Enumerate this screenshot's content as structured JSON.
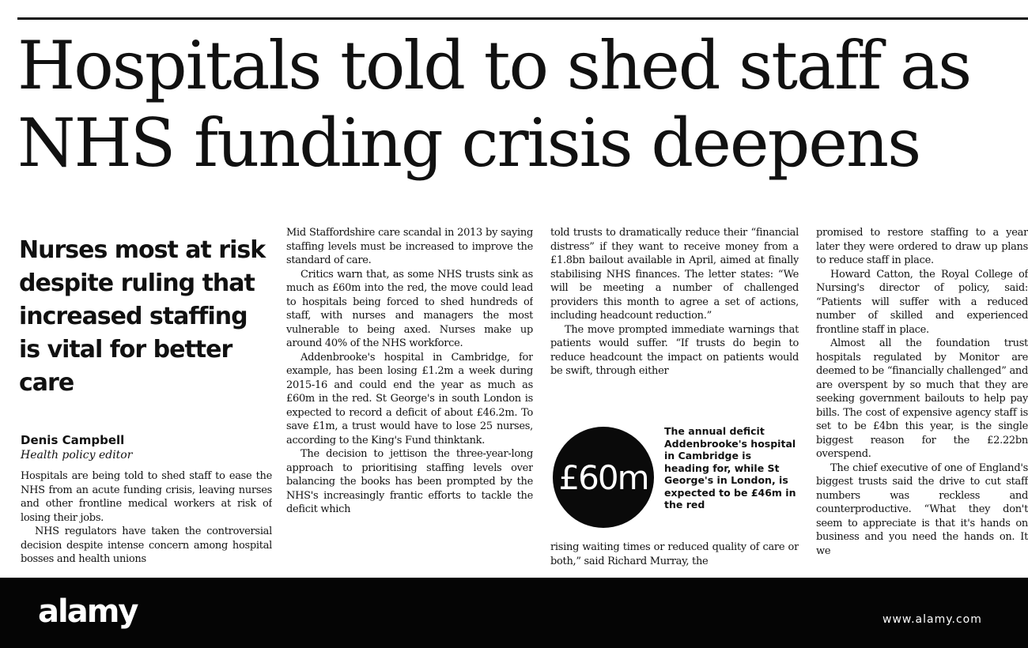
{
  "article": {
    "headline": [
      "Hospitals told to shed staff as",
      "NHS funding crisis deepens"
    ],
    "standfirst": "Nurses most at risk despite ruling that increased staffing is vital for better care",
    "byline": "Denis Campbell",
    "role": "Health policy editor",
    "col1": [
      "Hospitals are being told to shed staff to ease the NHS from an acute funding crisis, leaving nurses and other frontline medical workers at risk of losing their jobs.",
      "NHS regulators have taken the controversial decision despite intense concern among hospital bosses and health unions"
    ],
    "col2": [
      "Mid Staffordshire care scandal in 2013 by saying staffing levels must be increased to improve the standard of care.",
      "Critics warn that, as some NHS trusts sink as much as £60m into the red, the move could lead to hospitals being forced to shed hundreds of staff, with nurses and managers the most vulnerable to being axed. Nurses make up around 40% of the NHS workforce.",
      "Addenbrooke's hospital in Cambridge, for example, has been losing £1.2m a week during 2015-16 and could end the year as much as £60m in the red. St George's in south London is expected to record a deficit of about £46.2m. To save £1m, a trust would have to lose 25 nurses, according to the King's Fund thinktank.",
      "The decision to jettison the three-year-long approach to prioritising staffing levels over balancing the books has been prompted by the NHS's increasingly frantic efforts to tackle the deficit which"
    ],
    "col3": [
      "told trusts to dramatically reduce their “financial distress” if they want to receive money from a £1.8bn bailout available in April, aimed at finally stabilising NHS finances. The letter states: “We will be meeting a number of challenged providers this month to agree a set of actions, including headcount reduction.”",
      "The move prompted immediate warnings that patients would suffer. “If trusts do begin to reduce headcount the impact on patients would be swift, through either"
    ],
    "col3b": [
      "rising waiting times or reduced quality of care or both,” said Richard Murray, the"
    ],
    "col4": [
      "promised to restore staffing to a year later they were ordered to draw up plans to reduce staff in place.",
      "Howard Catton, the Royal College of Nursing's director of policy, said: “Patients will suffer with a reduced number of skilled and experienced frontline staff in place.",
      "Almost all the foundation trust hospitals regulated by Monitor are deemed to be “financially challenged” and are overspent by so much that they are seeking government bailouts to help pay bills. The cost of expensive agency staff is set to be £4bn this year, is the single biggest reason for the £2.22bn overspend.",
      "The chief executive of one of England's biggest trusts said the drive to cut staff numbers was reckless and counterproductive. “What they don't seem to appreciate is that it's hands on business and you need the hands on. It we"
    ],
    "callout_figure": "£60m",
    "callout_caption": "The annual deficit Addenbrooke's hospital in Cambridge is heading for, while St George's in London, is expected to be £46m in the red"
  },
  "watermark": {
    "logo": "alamy",
    "site": "www.alamy.com"
  }
}
